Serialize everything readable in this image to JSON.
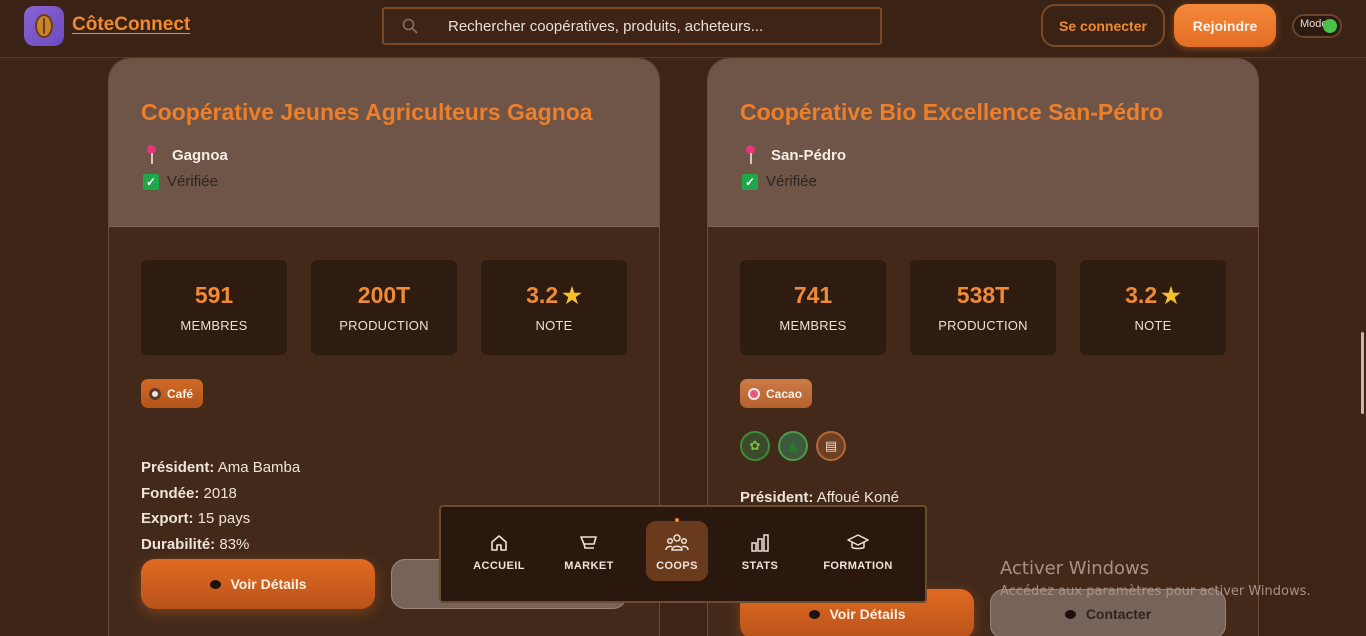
{
  "header": {
    "brand": "CôteConnect",
    "search_placeholder": "Rechercher coopératives, produits, acheteurs...",
    "login_label": "Se connecter",
    "join_label": "Rejoindre",
    "mode_label": "Mode"
  },
  "cards": [
    {
      "title": "Coopérative Jeunes Agriculteurs Gagnoa",
      "location": "Gagnoa",
      "verified": "Vérifiée",
      "stats": [
        {
          "value": "591",
          "label": "MEMBRES"
        },
        {
          "value": "200T",
          "label": "PRODUCTION"
        },
        {
          "value": "3.2",
          "label": "NOTE"
        }
      ],
      "tag": "Café",
      "president_label": "Président:",
      "president": "Ama Bamba",
      "founded_label": "Fondée:",
      "founded": "2018",
      "export_label": "Export:",
      "export": "15 pays",
      "durability_label": "Durabilité:",
      "durability": "83%",
      "details_label": "Voir Détails"
    },
    {
      "title": "Coopérative Bio Excellence San-Pédro",
      "location": "San-Pédro",
      "verified": "Vérifiée",
      "stats": [
        {
          "value": "741",
          "label": "MEMBRES"
        },
        {
          "value": "538T",
          "label": "PRODUCTION"
        },
        {
          "value": "3.2",
          "label": "NOTE"
        }
      ],
      "tag": "Cacao",
      "badges": [
        "seedling-icon",
        "tree-icon",
        "clipboard-icon"
      ],
      "president_label": "Président:",
      "president": "Affoué Koné",
      "details_label": "Voir Détails",
      "contact_label": "Contacter"
    }
  ],
  "bottom_nav": {
    "items": [
      {
        "label": "ACCUEIL",
        "icon": "home-icon"
      },
      {
        "label": "MARKET",
        "icon": "cart-icon"
      },
      {
        "label": "COOPS",
        "icon": "users-icon",
        "active": true
      },
      {
        "label": "STATS",
        "icon": "bar-chart-icon"
      },
      {
        "label": "FORMATION",
        "icon": "graduation-cap-icon"
      }
    ]
  },
  "watermark": {
    "title": "Activer Windows",
    "subtitle": "Accédez aux paramètres pour activer Windows."
  }
}
